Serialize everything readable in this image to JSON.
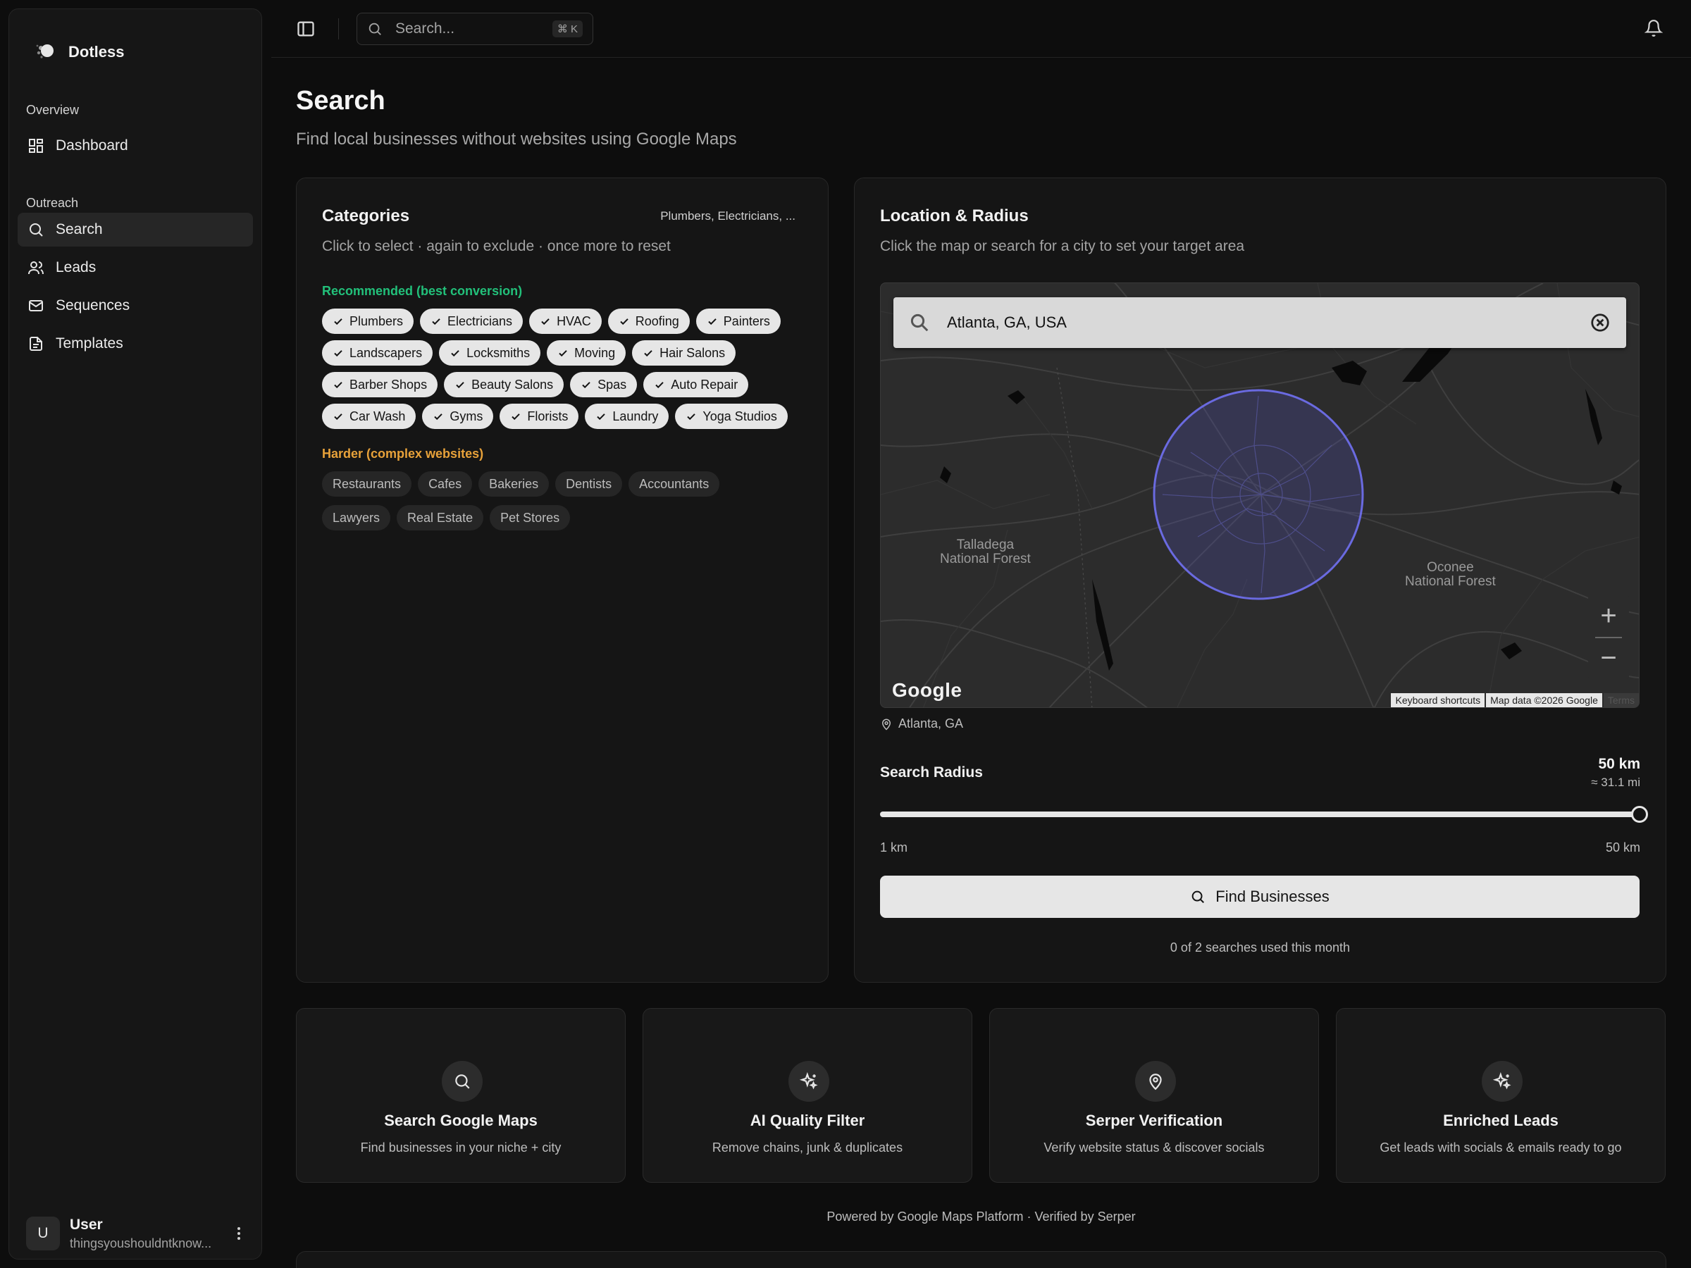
{
  "app": {
    "name": "Dotless"
  },
  "sidebar": {
    "groups": [
      {
        "label": "Overview",
        "items": [
          {
            "label": "Dashboard",
            "icon": "dashboard-icon",
            "active": false
          }
        ]
      },
      {
        "label": "Outreach",
        "items": [
          {
            "label": "Search",
            "icon": "search-icon",
            "active": true
          },
          {
            "label": "Leads",
            "icon": "users-icon",
            "active": false
          },
          {
            "label": "Sequences",
            "icon": "mail-icon",
            "active": false
          },
          {
            "label": "Templates",
            "icon": "file-icon",
            "active": false
          }
        ]
      }
    ],
    "user": {
      "initial": "U",
      "name": "User",
      "email": "thingsyoushouldntknow..."
    }
  },
  "topbar": {
    "search_placeholder": "Search...",
    "shortcut": "⌘ K"
  },
  "page": {
    "title": "Search",
    "subtitle": "Find local businesses without websites using Google Maps"
  },
  "categories": {
    "title": "Categories",
    "summary": "Plumbers, Electricians, ...",
    "hint": "Click to select · again to exclude · once more to reset",
    "recommended_label": "Recommended (best conversion)",
    "recommended_rows": [
      [
        "Plumbers",
        "Electricians",
        "HVAC",
        "Roofing",
        "Painters"
      ],
      [
        "Landscapers",
        "Locksmiths",
        "Moving",
        "Hair Salons"
      ],
      [
        "Barber Shops",
        "Beauty Salons",
        "Spas",
        "Auto Repair"
      ],
      [
        "Car Wash",
        "Gyms",
        "Florists",
        "Laundry",
        "Yoga Studios"
      ]
    ],
    "harder_label": "Harder (complex websites)",
    "harder_rows": [
      [
        "Restaurants",
        "Cafes",
        "Bakeries",
        "Dentists",
        "Accountants"
      ],
      [
        "Lawyers",
        "Real Estate",
        "Pet Stores"
      ]
    ]
  },
  "location": {
    "title": "Location & Radius",
    "desc": "Click the map or search for a city to set your target area",
    "map": {
      "search_value": "Atlanta, GA, USA",
      "places": [
        "Talladega\nNational Forest",
        "Oconee\nNational Forest"
      ],
      "logo": "Google",
      "attribution": [
        "Keyboard shortcuts",
        "Map data ©2026 Google",
        "Terms"
      ],
      "zoom_in": "+",
      "zoom_out": "−"
    },
    "selected_place": "Atlanta, GA",
    "radius": {
      "label": "Search Radius",
      "value_km": "50 km",
      "value_mi": "≈ 31.1 mi",
      "min_label": "1 km",
      "max_label": "50 km",
      "min": 1,
      "max": 50,
      "current": 50
    },
    "find_button": "Find Businesses",
    "usage": "0 of 2 searches used this month"
  },
  "features": [
    {
      "icon": "search-icon",
      "title": "Search Google Maps",
      "desc": "Find businesses in your niche + city"
    },
    {
      "icon": "sparkles-icon",
      "title": "AI Quality Filter",
      "desc": "Remove chains, junk & duplicates"
    },
    {
      "icon": "map-pin-icon",
      "title": "Serper Verification",
      "desc": "Verify website status & discover socials"
    },
    {
      "icon": "sparkles-icon",
      "title": "Enriched Leads",
      "desc": "Get leads with socials & emails ready to go"
    }
  ],
  "footer": "Powered by Google Maps Platform · Verified by Serper",
  "colors": {
    "accent_green": "#22c07a",
    "accent_amber": "#e8a23a",
    "radius_circle": "#5b5bd6"
  }
}
